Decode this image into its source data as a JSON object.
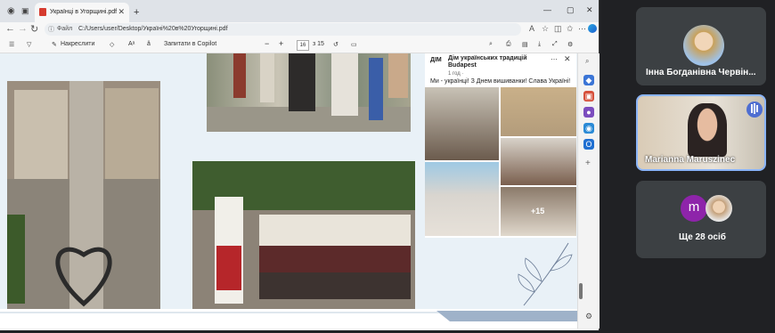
{
  "browser": {
    "tab_title": "Українці в Угорщині.pdf",
    "address_label": "Файл",
    "address_url": "C:/Users/user/Desktop/Україні%20в%20Угорщині.pdf"
  },
  "pdf_toolbar": {
    "draw_label": "Накреслити",
    "ask_copilot": "Запитати в Copilot",
    "page_current": "16",
    "page_total": "з 15",
    "minus": "−",
    "plus": "+"
  },
  "fb_post": {
    "org_short": "ДІМ",
    "org_name": "Дім українських традицій Budapest",
    "time": "1 год · ",
    "text": "Ми - українці! З Днем вишиванки! Слава Україні!",
    "more_count": "+15"
  },
  "meet": {
    "participant1_name": "Інна Богданівна Червін...",
    "participant2_name": "Marianna Maruszinec",
    "others_label": "Ще 28 осіб",
    "others_initial": "m"
  },
  "colors": {
    "accent": "#4f6ed1",
    "panel_bg": "#202124",
    "tile_bg": "#3c4043",
    "highlight_border": "#8ab4f8"
  }
}
